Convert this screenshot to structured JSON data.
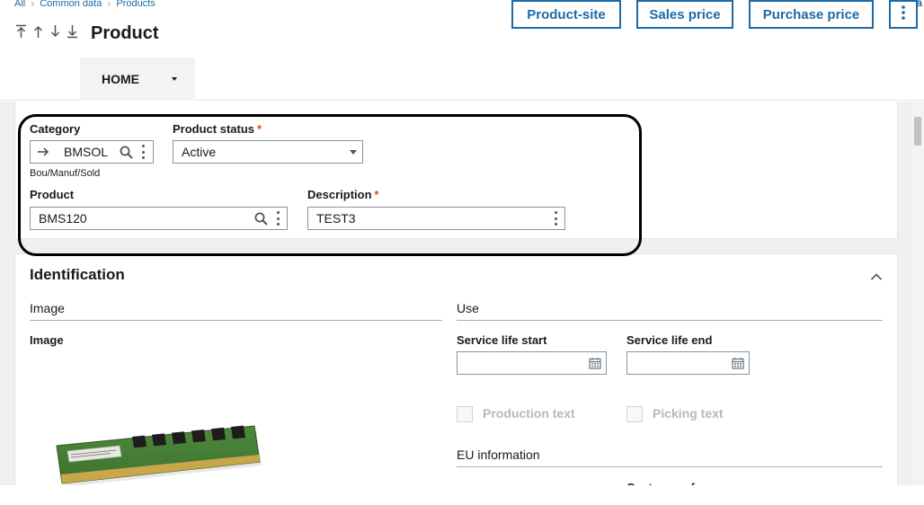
{
  "breadcrumb": [
    "All",
    "Common data",
    "Products"
  ],
  "header": {
    "default_link": "Defa",
    "title": "Product",
    "buttons": {
      "product_site": "Product-site",
      "sales_price": "Sales price",
      "purchase_price": "Purchase price"
    },
    "tab_home": "HOME"
  },
  "form": {
    "category": {
      "label": "Category",
      "value": "BMSOL",
      "subtext": "Bou/Manuf/Sold"
    },
    "product_status": {
      "label": "Product status",
      "value": "Active",
      "required": "*"
    },
    "product": {
      "label": "Product",
      "value": "BMS120"
    },
    "description": {
      "label": "Description",
      "value": "TEST3",
      "required": "*"
    }
  },
  "identification": {
    "title": "Identification",
    "image_section": "Image",
    "image_label": "Image",
    "use_section": "Use",
    "service_life_start": "Service life start",
    "service_life_end": "Service life end",
    "production_text": "Production text",
    "picking_text": "Picking text",
    "eu_information": "EU information",
    "customs_reference": "Customs reference"
  },
  "colors": {
    "accent": "#1c6aa6",
    "required": "#e04b16",
    "background": "#eef0f1"
  }
}
